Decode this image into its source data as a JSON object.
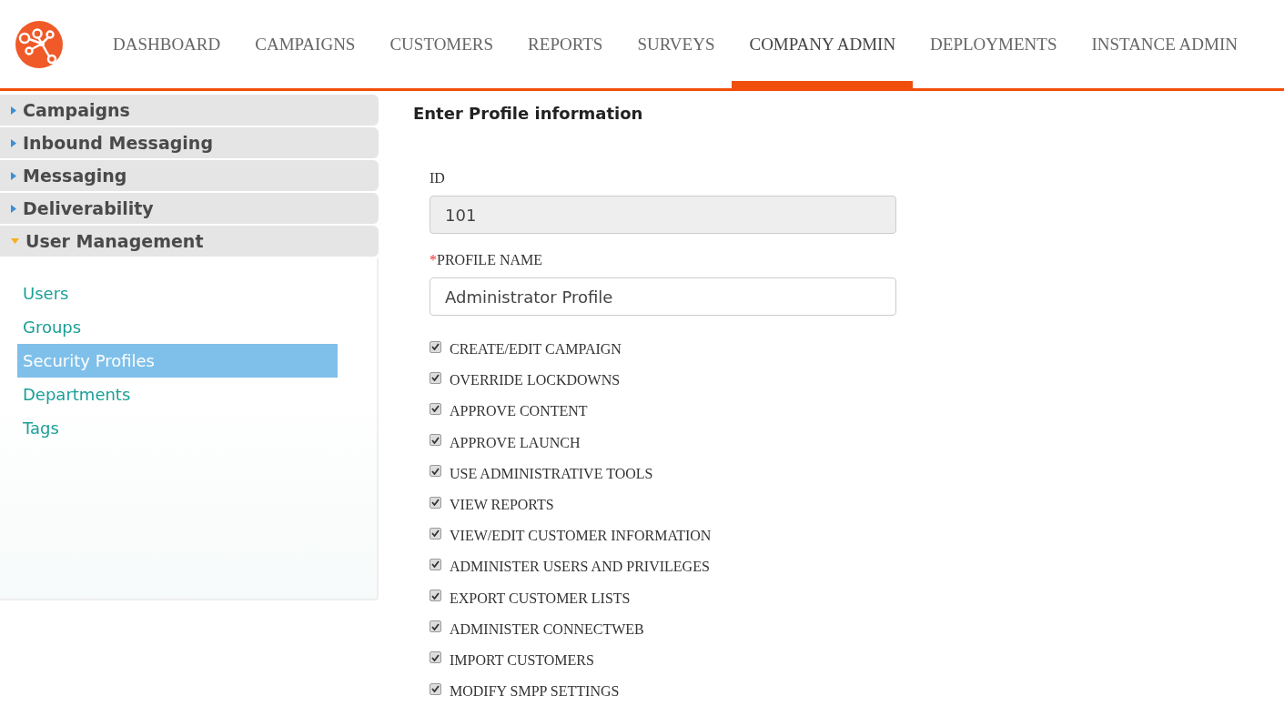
{
  "nav": {
    "tabs": [
      {
        "label": "DASHBOARD",
        "selected": false
      },
      {
        "label": "CAMPAIGNS",
        "selected": false
      },
      {
        "label": "CUSTOMERS",
        "selected": false
      },
      {
        "label": "REPORTS",
        "selected": false
      },
      {
        "label": "SURVEYS",
        "selected": false
      },
      {
        "label": "COMPANY ADMIN",
        "selected": true
      },
      {
        "label": "DEPLOYMENTS",
        "selected": false
      },
      {
        "label": "INSTANCE ADMIN",
        "selected": false
      }
    ]
  },
  "sidebar": {
    "sections": [
      {
        "label": "Campaigns",
        "expanded": false
      },
      {
        "label": "Inbound Messaging",
        "expanded": false
      },
      {
        "label": "Messaging",
        "expanded": false
      },
      {
        "label": "Deliverability",
        "expanded": false
      },
      {
        "label": "User Management",
        "expanded": true,
        "items": [
          {
            "label": "Users",
            "selected": false
          },
          {
            "label": "Groups",
            "selected": false
          },
          {
            "label": "Security Profiles",
            "selected": true
          },
          {
            "label": "Departments",
            "selected": false
          },
          {
            "label": "Tags",
            "selected": false
          }
        ]
      }
    ]
  },
  "form": {
    "title": "Enter Profile information",
    "fields": [
      {
        "label": "ID",
        "required": false,
        "value": "101",
        "disabled": true
      },
      {
        "label": "PROFILE NAME",
        "required": true,
        "required_mark": "*",
        "value": "Administrator Profile",
        "disabled": false
      }
    ],
    "permissions": [
      {
        "label": "CREATE/EDIT CAMPAIGN",
        "checked": true
      },
      {
        "label": "OVERRIDE LOCKDOWNS",
        "checked": true
      },
      {
        "label": "APPROVE CONTENT",
        "checked": true
      },
      {
        "label": "APPROVE LAUNCH",
        "checked": true
      },
      {
        "label": "USE ADMINISTRATIVE TOOLS",
        "checked": true
      },
      {
        "label": "VIEW REPORTS",
        "checked": true
      },
      {
        "label": "VIEW/EDIT CUSTOMER INFORMATION",
        "checked": true
      },
      {
        "label": "ADMINISTER USERS AND PRIVILEGES",
        "checked": true
      },
      {
        "label": "EXPORT CUSTOMER LISTS",
        "checked": true
      },
      {
        "label": "ADMINISTER CONNECTWEB",
        "checked": true
      },
      {
        "label": "IMPORT CUSTOMERS",
        "checked": true
      },
      {
        "label": "MODIFY SMPP SETTINGS",
        "checked": true
      }
    ]
  }
}
